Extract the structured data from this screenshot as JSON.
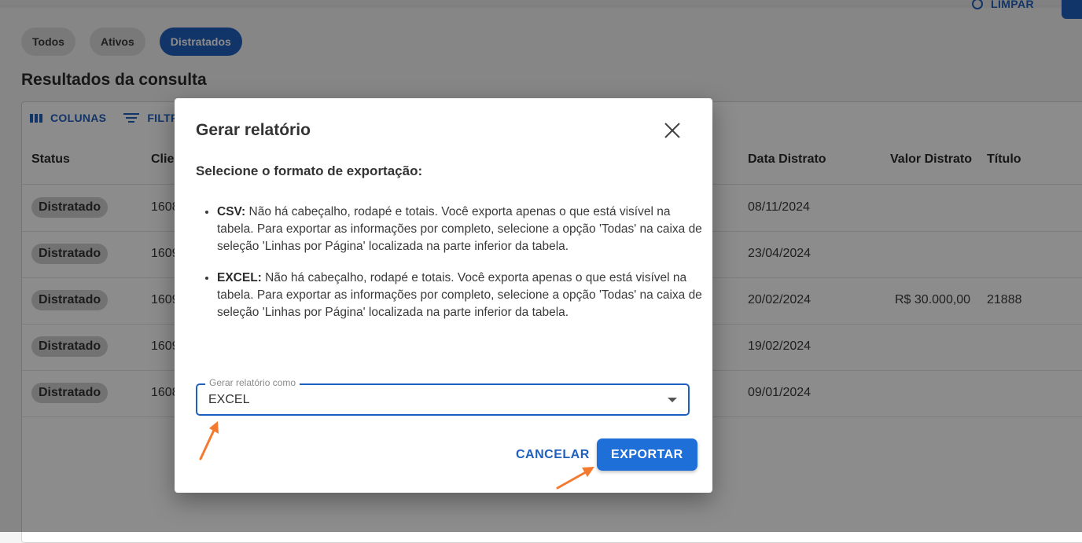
{
  "header": {
    "clear_label": "LIMPAR"
  },
  "filters": {
    "chips": [
      "Todos",
      "Ativos",
      "Distratados"
    ],
    "active": "Distratados"
  },
  "results": {
    "title": "Resultados da consulta",
    "toolbar": {
      "columns_label": "COLUNAS",
      "filter_label": "FILTR"
    },
    "columns": {
      "status": "Status",
      "client": "Clie",
      "date": "Data Distrato",
      "value": "Valor Distrato",
      "title": "Título"
    },
    "rows": [
      {
        "status": "Distratado",
        "client": "1608",
        "date": "08/11/2024",
        "value": "",
        "title": ""
      },
      {
        "status": "Distratado",
        "client": "1609",
        "date": "23/04/2024",
        "value": "",
        "title": ""
      },
      {
        "status": "Distratado",
        "client": "1609",
        "date": "20/02/2024",
        "value": "R$ 30.000,00",
        "title": "21888"
      },
      {
        "status": "Distratado",
        "client": "1609",
        "date": "19/02/2024",
        "value": "",
        "title": ""
      },
      {
        "status": "Distratado",
        "client": "1608",
        "date": "09/01/2024",
        "value": "",
        "title": ""
      }
    ]
  },
  "dialog": {
    "title": "Gerar relatório",
    "subtitle": "Selecione o formato de exportação:",
    "options": [
      {
        "name": "CSV:",
        "text": "Não há cabeçalho, rodapé e totais. Você exporta apenas o que está visível na tabela. Para exportar as informações por completo, selecione a opção 'Todas' na caixa de seleção 'Linhas por Página' localizada na parte inferior da tabela."
      },
      {
        "name": "EXCEL:",
        "text": "Não há cabeçalho, rodapé e totais. Você exporta apenas o que está visível na tabela. Para exportar as informações por completo, selecione a opção 'Todas' na caixa de seleção 'Linhas por Página' localizada na parte inferior da tabela."
      }
    ],
    "select": {
      "label": "Gerar relatório como",
      "value": "EXCEL"
    },
    "cancel_label": "CANCELAR",
    "export_label": "EXPORTAR"
  },
  "colors": {
    "primary": "#1f5fbf",
    "button": "#1f6fd9",
    "annotation_arrow": "#f47a30"
  },
  "icons": [
    "broom-icon",
    "search-icon",
    "columns-icon",
    "filter-icon",
    "close-icon",
    "caret-down-icon",
    "arrow-annotation-icon"
  ]
}
